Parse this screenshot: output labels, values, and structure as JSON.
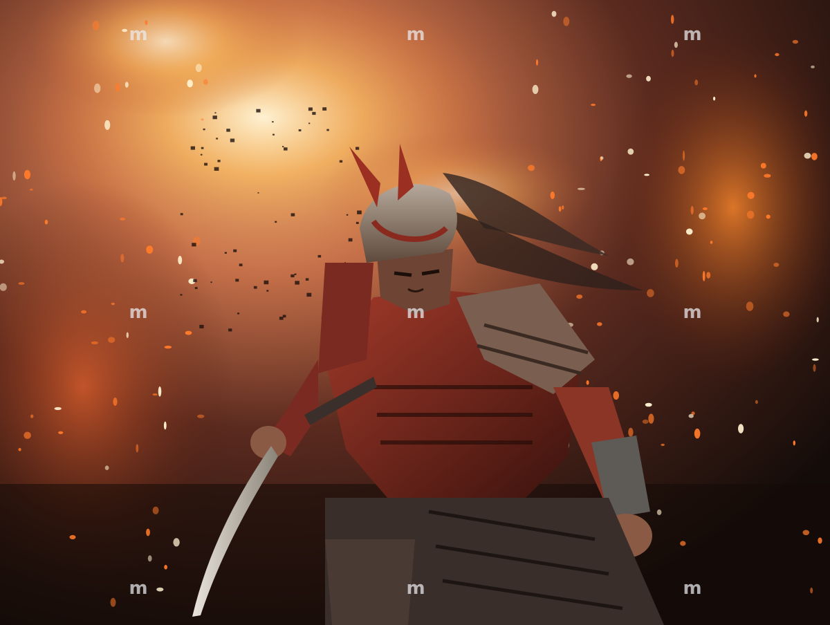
{
  "image": {
    "subject": "armored-warrior-with-sword",
    "palette": {
      "fire": "#f6b35a",
      "fire_hot": "#fff1cf",
      "ember": "#ff7a2a",
      "smoke": "#5a2d22",
      "shadow": "#120b08",
      "armor_red": "#8a2a1f",
      "steel": "#b9b2a8"
    }
  },
  "watermark": {
    "text": "m",
    "count": 9
  }
}
